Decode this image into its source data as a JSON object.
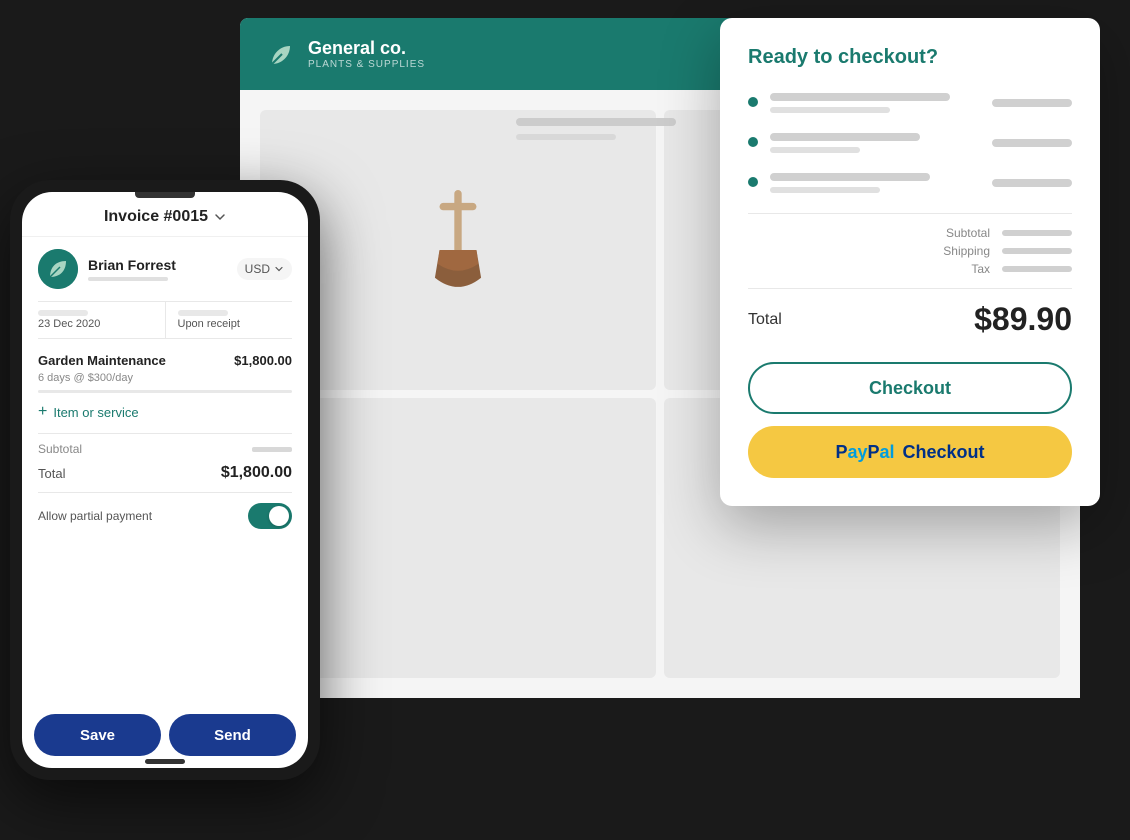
{
  "app": {
    "company_name": "General co.",
    "company_sub": "PLANTS & SUPPLIES",
    "background": "#1a1a1a"
  },
  "checkout_modal": {
    "title": "Ready to checkout?",
    "total_label": "Total",
    "total_amount": "$89.90",
    "checkout_button": "Checkout",
    "paypal_text": "Checkout",
    "subtotal_label": "Subtotal",
    "shipping_label": "Shipping",
    "tax_label": "Tax"
  },
  "invoice": {
    "title": "Invoice #0015",
    "client_name": "Brian Forrest",
    "currency": "USD",
    "date_label": "23 Dec 2020",
    "payment_label": "Upon receipt",
    "item_name": "Garden Maintenance",
    "item_price": "$1,800.00",
    "item_desc": "6 days @ $300/day",
    "add_item_label": "Item or service",
    "subtotal_label": "Subtotal",
    "total_label": "Total",
    "total_value": "$1,800.00",
    "partial_payment_label": "Allow partial payment",
    "save_button": "Save",
    "send_button": "Send"
  }
}
